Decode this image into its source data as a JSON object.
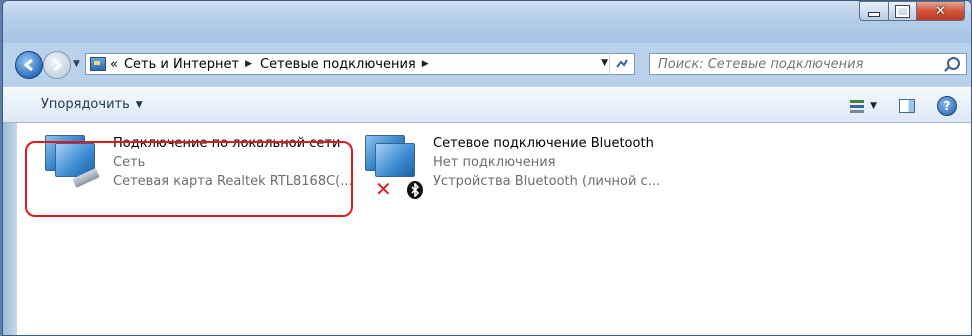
{
  "window": {
    "caption_buttons": {
      "minimize": "minimize",
      "maximize": "maximize",
      "close": "x"
    }
  },
  "address": {
    "overflow": "«",
    "crumbs": [
      "Сеть и Интернет",
      "Сетевые подключения"
    ],
    "separator": "▶"
  },
  "search": {
    "placeholder": "Поиск: Сетевые подключения"
  },
  "toolbar": {
    "organize_label": "Упорядочить",
    "help": "?"
  },
  "items": [
    {
      "title": "Подключение по локальной сети",
      "status": "Сеть",
      "device": "Сетевая карта Realtek RTL8168C(...",
      "icon": "network-lan-icon"
    },
    {
      "title": "Сетевое подключение Bluetooth",
      "status": "Нет подключения",
      "device": "Устройства Bluetooth (личной с...",
      "icon": "network-bluetooth-icon",
      "badge": "ʙ"
    }
  ],
  "colors": {
    "highlight": "#e0191f",
    "window_frame": "#b9d1ea"
  }
}
